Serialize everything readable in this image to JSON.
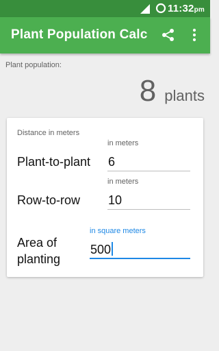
{
  "status_bar": {
    "time": "11:32",
    "ampm": "pm"
  },
  "app_bar": {
    "title": "Plant Population Calc",
    "share_icon": "share-icon",
    "more_icon": "more-vert-icon"
  },
  "result": {
    "label": "Plant population:",
    "value": "8",
    "unit": "plants"
  },
  "form": {
    "section_label": "Distance in meters",
    "plant_to_plant": {
      "label": "Plant-to-plant",
      "hint": "in meters",
      "value": "6"
    },
    "row_to_row": {
      "label": "Row-to-row",
      "hint": "in meters",
      "value": "10"
    },
    "area": {
      "label_line1": "Area of",
      "label_line2": "planting",
      "hint": "in square meters",
      "value": "500"
    }
  },
  "colors": {
    "status_bar": "#388e3c",
    "app_bar": "#4caf50",
    "accent": "#1e88e5"
  }
}
